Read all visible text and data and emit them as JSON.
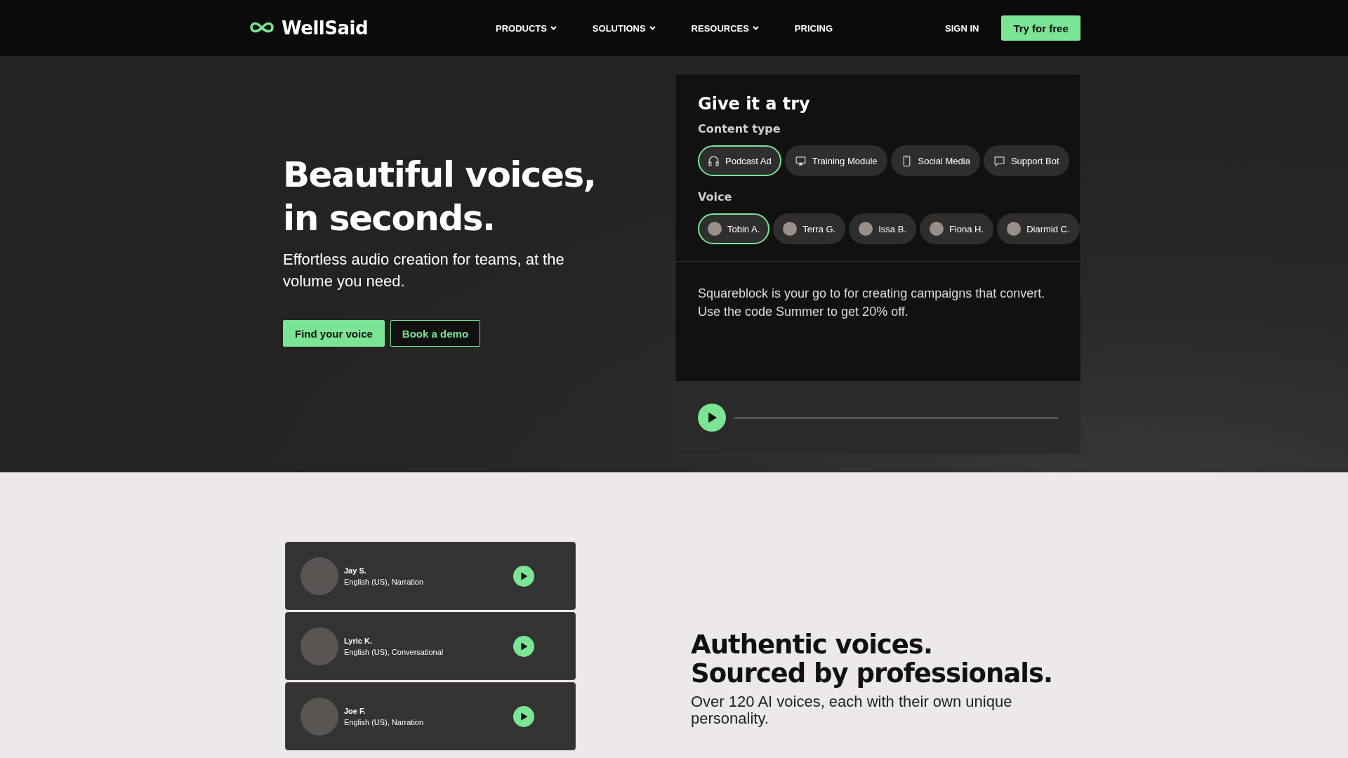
{
  "nav": {
    "logo": "WellSaid",
    "items": [
      {
        "label": "PRODUCTS",
        "dropdown": true
      },
      {
        "label": "SOLUTIONS",
        "dropdown": true
      },
      {
        "label": "RESOURCES",
        "dropdown": true
      },
      {
        "label": "PRICING",
        "dropdown": false
      }
    ],
    "sign_in": "SIGN IN",
    "cta": "Try for free"
  },
  "hero": {
    "title_lines": [
      "Beautiful voices,",
      "in seconds."
    ],
    "subtitle": "Effortless audio creation for teams, at the volume you need.",
    "buttons": [
      {
        "label": "Find your voice",
        "kind": "primary"
      },
      {
        "label": "Book a demo",
        "kind": "outline"
      }
    ]
  },
  "try_card": {
    "title": "Give it a try",
    "content_type_label": "Content type",
    "content_types": [
      {
        "label": "Podcast Ad",
        "kind": "headphones",
        "selected": true
      },
      {
        "label": "Training Module",
        "kind": "presentation",
        "selected": false
      },
      {
        "label": "Social Media",
        "kind": "phone",
        "selected": false
      },
      {
        "label": "Support Bot",
        "kind": "chat",
        "selected": false
      }
    ],
    "voice_label": "Voice",
    "voices": [
      {
        "label": "Tobin A.",
        "selected": true
      },
      {
        "label": "Terra G.",
        "selected": false
      },
      {
        "label": "Issa B.",
        "selected": false
      },
      {
        "label": "Fiona H.",
        "selected": false
      },
      {
        "label": "Diarmid C.",
        "selected": false
      }
    ],
    "script": "Squareblock is your go to for creating campaigns that convert. Use the code Summer to get 20% off."
  },
  "voice_list": [
    {
      "name": "Jay S.",
      "description": "English (US), Narration"
    },
    {
      "name": "Lyric K.",
      "description": "English (US), Conversational"
    },
    {
      "name": "Joe F.",
      "description": "English (US), Narration"
    }
  ],
  "authentic": {
    "title_lines": [
      "Authentic voices.",
      "Sourced by professionals."
    ],
    "subtitle": "Over 120 AI voices, each with their own unique personality."
  }
}
